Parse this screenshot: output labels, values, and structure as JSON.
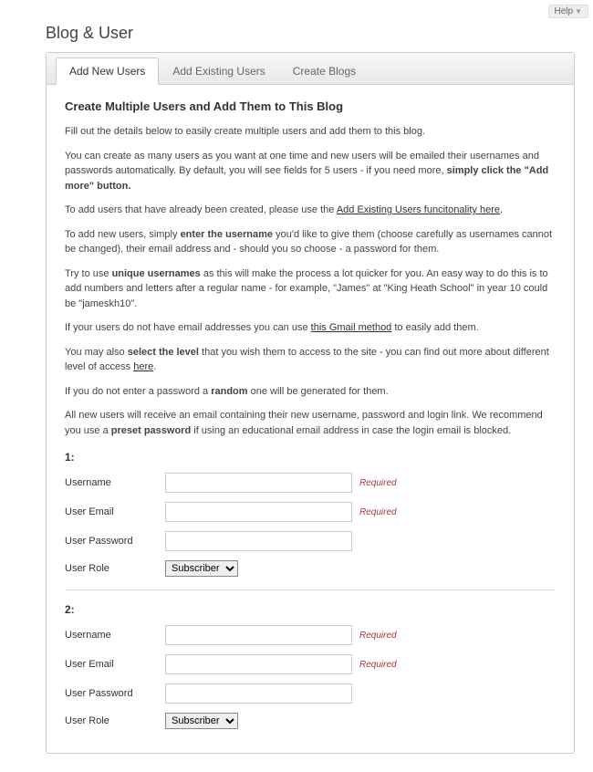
{
  "help_label": "Help",
  "page_title": "Blog & User",
  "tabs": [
    {
      "label": "Add New Users"
    },
    {
      "label": "Add Existing Users"
    },
    {
      "label": "Create Blogs"
    }
  ],
  "heading": "Create Multiple Users and Add Them to This Blog",
  "p1": "Fill out the details below to easily create multiple users and add them to this blog.",
  "p2a": "You can create as many users as you want at one time and new users will be emailed their usernames and passwords automatically. By default, you will see fields for 5 users - if you need more, ",
  "p2b": "simply click the \"Add more\" button.",
  "p3a": "To add users that have already been created, please use the ",
  "p3link": "Add Existing Users funcitonality here",
  "p3b": ".",
  "p4a": "To add new users, simply ",
  "p4b": "enter the username",
  "p4c": " you'd like to give them (choose carefully as usernames cannot be changed), their email address and - should you so choose - a password for them.",
  "p5a": "Try to use ",
  "p5b": "unique usernames",
  "p5c": " as this will make the process a lot quicker for you. An easy way to do this is to add numbers and letters after a regular name - for example, \"James\" at \"King Heath School\" in year 10 could be \"jameskh10\".",
  "p6a": "If your users do not have email addresses you can use ",
  "p6link": "this Gmail method",
  "p6b": " to easily add them.",
  "p7a": "You may also ",
  "p7b": "select the level",
  "p7c": " that you wish them to access to the site - you can find out more about different level of access ",
  "p7link": "here",
  "p7d": ".",
  "p8a": "If you do not enter a password a ",
  "p8b": "random",
  "p8c": " one will be generated for them.",
  "p9a": "All new users will receive an email containing their new username, password and login link. We recommend you use a ",
  "p9b": "preset password",
  "p9c": " if using an educational email address in case the login email is blocked.",
  "labels": {
    "username": "Username",
    "email": "User Email",
    "password": "User Password",
    "role": "User Role"
  },
  "required": "Required",
  "role_default": "Subscriber",
  "sections": [
    {
      "num": "1:"
    },
    {
      "num": "2:"
    }
  ]
}
